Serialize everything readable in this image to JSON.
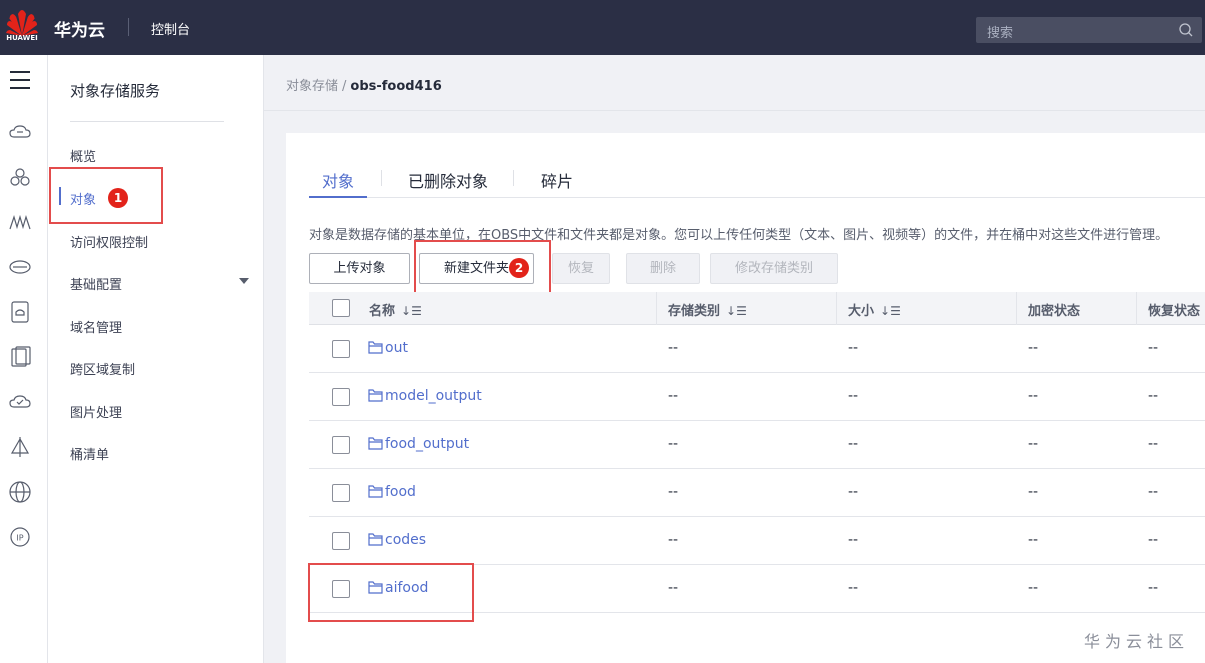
{
  "header": {
    "logo_text": "HUAWEI",
    "brand": "华为云",
    "console": "控制台",
    "search_placeholder": "搜索"
  },
  "rail": {
    "icons": [
      "menu-icon",
      "cloud-icon",
      "nodes-icon",
      "layers-icon",
      "disk-icon",
      "storage-icon",
      "server-icon",
      "cloud-check-icon",
      "pin-icon",
      "globe-icon",
      "ip-icon"
    ]
  },
  "sidemenu": {
    "title": "对象存储服务",
    "items": [
      {
        "label": "概览"
      },
      {
        "label": "对象"
      },
      {
        "label": "访问权限控制"
      },
      {
        "label": "基础配置"
      },
      {
        "label": "域名管理"
      },
      {
        "label": "跨区域复制"
      },
      {
        "label": "图片处理"
      },
      {
        "label": "桶清单"
      }
    ],
    "active_index": 1
  },
  "breadcrumb": {
    "parent": "对象存储",
    "separator": "/",
    "current": "obs-food416"
  },
  "tabs": [
    {
      "label": "对象"
    },
    {
      "label": "已删除对象"
    },
    {
      "label": "碎片"
    }
  ],
  "description": "对象是数据存储的基本单位，在OBS中文件和文件夹都是对象。您可以上传任何类型（文本、图片、视频等）的文件，并在桶中对这些文件进行管理。",
  "toolbar": {
    "upload": "上传对象",
    "new_folder": "新建文件夹",
    "restore": "恢复",
    "delete": "删除",
    "change_class": "修改存储类别"
  },
  "annotations": {
    "badge1": "1",
    "badge2": "2"
  },
  "table": {
    "columns": [
      "名称",
      "存储类别",
      "大小",
      "加密状态",
      "恢复状态"
    ],
    "sort_icon": "↓☰",
    "rows": [
      {
        "name": "out",
        "class": "--",
        "size": "--",
        "enc": "--",
        "restore": "--"
      },
      {
        "name": "model_output",
        "class": "--",
        "size": "--",
        "enc": "--",
        "restore": "--"
      },
      {
        "name": "food_output",
        "class": "--",
        "size": "--",
        "enc": "--",
        "restore": "--"
      },
      {
        "name": "food",
        "class": "--",
        "size": "--",
        "enc": "--",
        "restore": "--"
      },
      {
        "name": "codes",
        "class": "--",
        "size": "--",
        "enc": "--",
        "restore": "--"
      },
      {
        "name": "aifood",
        "class": "--",
        "size": "--",
        "enc": "--",
        "restore": "--"
      }
    ]
  },
  "watermark": "华为云社区",
  "colors": {
    "topbar": "#2b2f45",
    "accent": "#526ecc",
    "highlight": "#e34c4c",
    "badge": "#e2231a"
  }
}
